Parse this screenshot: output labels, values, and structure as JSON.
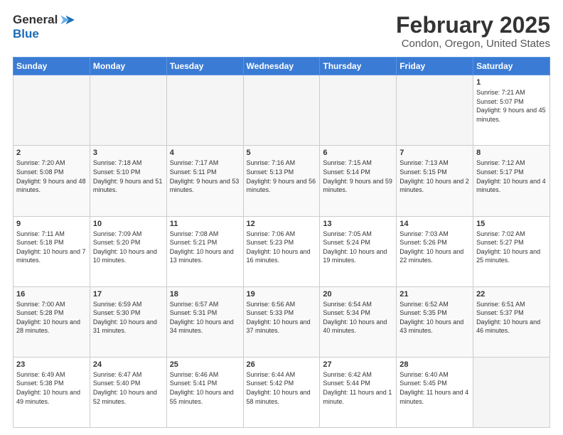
{
  "logo": {
    "general": "General",
    "blue": "Blue"
  },
  "header": {
    "month": "February 2025",
    "location": "Condon, Oregon, United States"
  },
  "weekdays": [
    "Sunday",
    "Monday",
    "Tuesday",
    "Wednesday",
    "Thursday",
    "Friday",
    "Saturday"
  ],
  "weeks": [
    [
      {
        "day": "",
        "info": ""
      },
      {
        "day": "",
        "info": ""
      },
      {
        "day": "",
        "info": ""
      },
      {
        "day": "",
        "info": ""
      },
      {
        "day": "",
        "info": ""
      },
      {
        "day": "",
        "info": ""
      },
      {
        "day": "1",
        "info": "Sunrise: 7:21 AM\nSunset: 5:07 PM\nDaylight: 9 hours and 45 minutes."
      }
    ],
    [
      {
        "day": "2",
        "info": "Sunrise: 7:20 AM\nSunset: 5:08 PM\nDaylight: 9 hours and 48 minutes."
      },
      {
        "day": "3",
        "info": "Sunrise: 7:18 AM\nSunset: 5:10 PM\nDaylight: 9 hours and 51 minutes."
      },
      {
        "day": "4",
        "info": "Sunrise: 7:17 AM\nSunset: 5:11 PM\nDaylight: 9 hours and 53 minutes."
      },
      {
        "day": "5",
        "info": "Sunrise: 7:16 AM\nSunset: 5:13 PM\nDaylight: 9 hours and 56 minutes."
      },
      {
        "day": "6",
        "info": "Sunrise: 7:15 AM\nSunset: 5:14 PM\nDaylight: 9 hours and 59 minutes."
      },
      {
        "day": "7",
        "info": "Sunrise: 7:13 AM\nSunset: 5:15 PM\nDaylight: 10 hours and 2 minutes."
      },
      {
        "day": "8",
        "info": "Sunrise: 7:12 AM\nSunset: 5:17 PM\nDaylight: 10 hours and 4 minutes."
      }
    ],
    [
      {
        "day": "9",
        "info": "Sunrise: 7:11 AM\nSunset: 5:18 PM\nDaylight: 10 hours and 7 minutes."
      },
      {
        "day": "10",
        "info": "Sunrise: 7:09 AM\nSunset: 5:20 PM\nDaylight: 10 hours and 10 minutes."
      },
      {
        "day": "11",
        "info": "Sunrise: 7:08 AM\nSunset: 5:21 PM\nDaylight: 10 hours and 13 minutes."
      },
      {
        "day": "12",
        "info": "Sunrise: 7:06 AM\nSunset: 5:23 PM\nDaylight: 10 hours and 16 minutes."
      },
      {
        "day": "13",
        "info": "Sunrise: 7:05 AM\nSunset: 5:24 PM\nDaylight: 10 hours and 19 minutes."
      },
      {
        "day": "14",
        "info": "Sunrise: 7:03 AM\nSunset: 5:26 PM\nDaylight: 10 hours and 22 minutes."
      },
      {
        "day": "15",
        "info": "Sunrise: 7:02 AM\nSunset: 5:27 PM\nDaylight: 10 hours and 25 minutes."
      }
    ],
    [
      {
        "day": "16",
        "info": "Sunrise: 7:00 AM\nSunset: 5:28 PM\nDaylight: 10 hours and 28 minutes."
      },
      {
        "day": "17",
        "info": "Sunrise: 6:59 AM\nSunset: 5:30 PM\nDaylight: 10 hours and 31 minutes."
      },
      {
        "day": "18",
        "info": "Sunrise: 6:57 AM\nSunset: 5:31 PM\nDaylight: 10 hours and 34 minutes."
      },
      {
        "day": "19",
        "info": "Sunrise: 6:56 AM\nSunset: 5:33 PM\nDaylight: 10 hours and 37 minutes."
      },
      {
        "day": "20",
        "info": "Sunrise: 6:54 AM\nSunset: 5:34 PM\nDaylight: 10 hours and 40 minutes."
      },
      {
        "day": "21",
        "info": "Sunrise: 6:52 AM\nSunset: 5:35 PM\nDaylight: 10 hours and 43 minutes."
      },
      {
        "day": "22",
        "info": "Sunrise: 6:51 AM\nSunset: 5:37 PM\nDaylight: 10 hours and 46 minutes."
      }
    ],
    [
      {
        "day": "23",
        "info": "Sunrise: 6:49 AM\nSunset: 5:38 PM\nDaylight: 10 hours and 49 minutes."
      },
      {
        "day": "24",
        "info": "Sunrise: 6:47 AM\nSunset: 5:40 PM\nDaylight: 10 hours and 52 minutes."
      },
      {
        "day": "25",
        "info": "Sunrise: 6:46 AM\nSunset: 5:41 PM\nDaylight: 10 hours and 55 minutes."
      },
      {
        "day": "26",
        "info": "Sunrise: 6:44 AM\nSunset: 5:42 PM\nDaylight: 10 hours and 58 minutes."
      },
      {
        "day": "27",
        "info": "Sunrise: 6:42 AM\nSunset: 5:44 PM\nDaylight: 11 hours and 1 minute."
      },
      {
        "day": "28",
        "info": "Sunrise: 6:40 AM\nSunset: 5:45 PM\nDaylight: 11 hours and 4 minutes."
      },
      {
        "day": "",
        "info": ""
      }
    ]
  ]
}
